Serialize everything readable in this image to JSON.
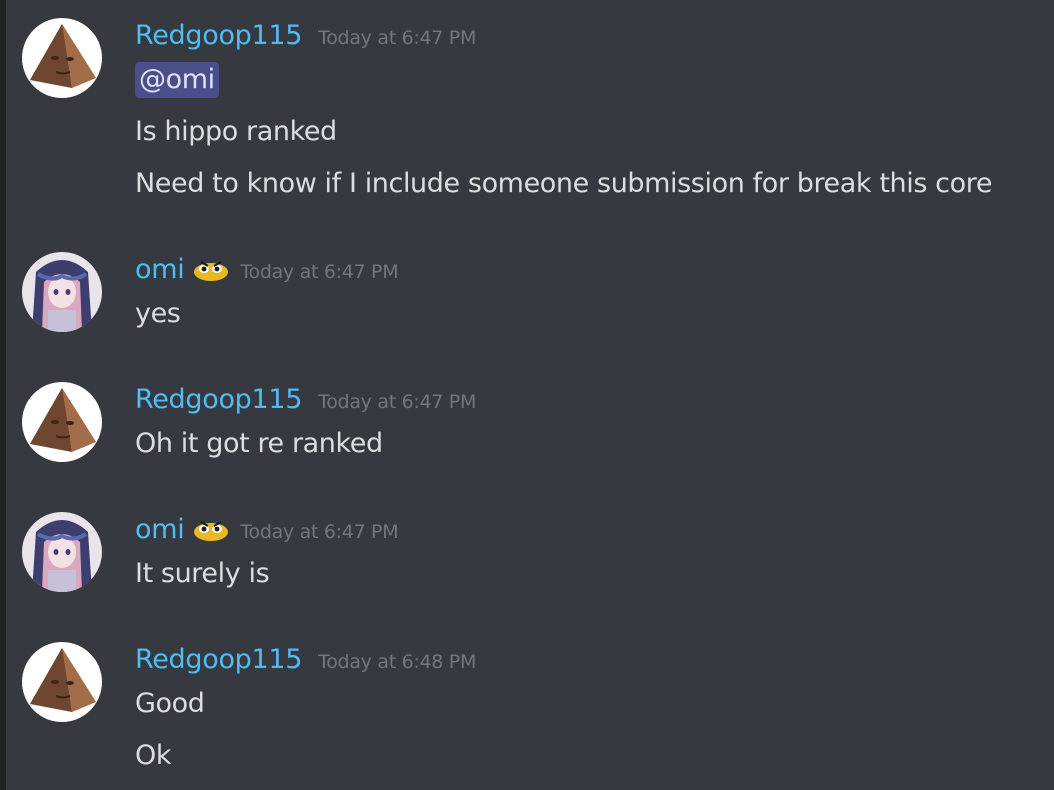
{
  "colors": {
    "background": "#36393f",
    "redgoop_name": "#4fbdf1",
    "omi_name": "#4fbdf1",
    "timestamp": "#72767d",
    "message_text": "#dcddde",
    "mention_bg": "#4a4e8a",
    "mention_text": "#dee0fc"
  },
  "messages": [
    {
      "author": "Redgoop115",
      "avatar_icon": "pyramid-face-avatar",
      "timestamp": "Today at 6:47 PM",
      "mention": "@omi",
      "lines": [
        "Is hippo ranked",
        "Need to know if I include someone submission for break this core"
      ]
    },
    {
      "author": "omi",
      "avatar_icon": "anime-girl-avatar",
      "badge_icon": "yellow-blob-emoji",
      "timestamp": "Today at 6:47 PM",
      "lines": [
        "yes"
      ]
    },
    {
      "author": "Redgoop115",
      "avatar_icon": "pyramid-face-avatar",
      "timestamp": "Today at 6:47 PM",
      "lines": [
        "Oh it got re ranked"
      ]
    },
    {
      "author": "omi",
      "avatar_icon": "anime-girl-avatar",
      "badge_icon": "yellow-blob-emoji",
      "timestamp": "Today at 6:47 PM",
      "lines": [
        "It surely is"
      ]
    },
    {
      "author": "Redgoop115",
      "avatar_icon": "pyramid-face-avatar",
      "timestamp": "Today at 6:48 PM",
      "lines": [
        "Good",
        "Ok"
      ]
    }
  ]
}
